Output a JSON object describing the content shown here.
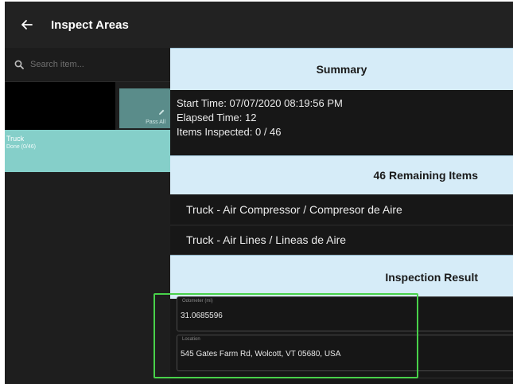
{
  "appbar": {
    "title": "Inspect Areas",
    "back_icon": "arrow-left-icon"
  },
  "search": {
    "placeholder": "Search item..."
  },
  "pass_all": {
    "label": "Pass All",
    "icon": "pencil-icon"
  },
  "areas": [
    {
      "name": "Truck",
      "status": "Done (0/46)"
    }
  ],
  "summary": {
    "title": "Summary",
    "start_time": "Start Time: 07/07/2020 08:19:56 PM",
    "elapsed_time": "Elapsed Time: 12",
    "items_inspected": "Items Inspected: 0 / 46"
  },
  "remaining": {
    "title": "46 Remaining Items",
    "items": [
      "Truck - Air Compressor / Compresor de Aire",
      "Truck - Air Lines / Lineas de Aire"
    ]
  },
  "result": {
    "title": "Inspection Result",
    "odometer_label": "Odometer (mi)",
    "odometer_value": "31.0685596",
    "location_label": "Location",
    "location_value": "545 Gates Farm Rd, Wolcott, VT 05680, USA"
  },
  "colors": {
    "header_bg": "#d6ecf8",
    "area_selected": "#85cfc9",
    "highlight": "#48d14a"
  }
}
